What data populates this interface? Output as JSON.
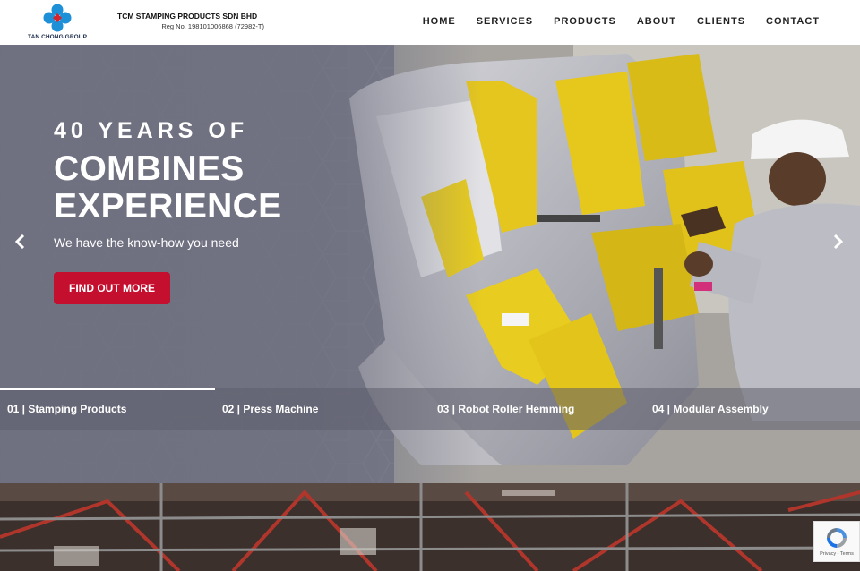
{
  "header": {
    "logo_caption": "TAN CHONG GROUP",
    "company_name": "TCM STAMPING PRODUCTS SDN BHD",
    "company_reg": "Reg No. 198101006868 (72982-T)",
    "nav": [
      "HOME",
      "SERVICES",
      "PRODUCTS",
      "ABOUT",
      "CLIENTS",
      "CONTACT"
    ]
  },
  "hero": {
    "kicker": "40 YEARS OF",
    "headline_line1": "COMBINES",
    "headline_line2": "EXPERIENCE",
    "tagline": "We have the know-how you need",
    "cta_label": "FIND OUT MORE",
    "prev_icon": "chevron-left-icon",
    "next_icon": "chevron-right-icon",
    "tabs": [
      "01 | Stamping Products",
      "02 | Press Machine",
      "03 | Robot Roller Hemming",
      "04 | Modular Assembly"
    ],
    "active_tab": 0
  },
  "recaptcha": {
    "links": "Privacy - Terms",
    "icon": "recaptcha-icon"
  },
  "colors": {
    "accent": "#c4102e",
    "hero_overlay": "#6e7080",
    "text_dark": "#222222",
    "logo_blue": "#1e90d8",
    "logo_red": "#d8232a"
  }
}
